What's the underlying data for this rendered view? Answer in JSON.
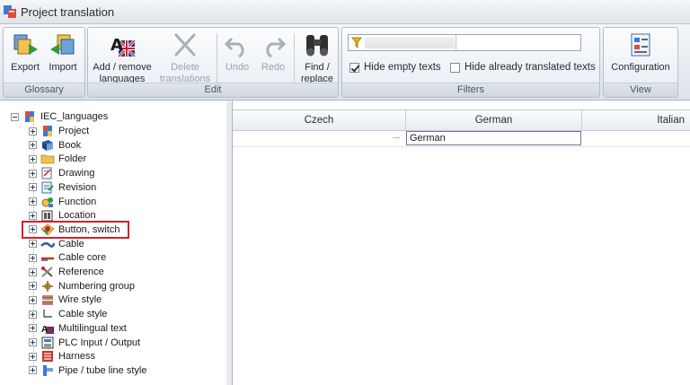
{
  "window": {
    "title": "Project translation"
  },
  "ribbon": {
    "glossary": {
      "label": "Glossary",
      "export_label": "Export",
      "import_label": "Import"
    },
    "edit": {
      "label": "Edit",
      "add_remove_line1": "Add / remove",
      "add_remove_line2": "languages",
      "delete_line1": "Delete",
      "delete_line2": "translations",
      "undo_label": "Undo",
      "redo_label": "Redo",
      "find_line1": "Find /",
      "find_line2": "replace"
    },
    "filters": {
      "label": "Filters",
      "hide_empty_label": "Hide empty texts",
      "hide_translated_label": "Hide already translated texts"
    },
    "view": {
      "label": "View",
      "configuration_label": "Configuration"
    }
  },
  "tree": {
    "root": "IEC_languages",
    "items": [
      {
        "label": "Project",
        "icon": "project-icon"
      },
      {
        "label": "Book",
        "icon": "book-icon"
      },
      {
        "label": "Folder",
        "icon": "folder-icon"
      },
      {
        "label": "Drawing",
        "icon": "drawing-icon"
      },
      {
        "label": "Revision",
        "icon": "revision-icon"
      },
      {
        "label": "Function",
        "icon": "function-icon"
      },
      {
        "label": "Location",
        "icon": "location-icon"
      },
      {
        "label": "Button, switch",
        "icon": "button-switch-icon"
      },
      {
        "label": "Cable",
        "icon": "cable-icon"
      },
      {
        "label": "Cable core",
        "icon": "cable-core-icon"
      },
      {
        "label": "Reference",
        "icon": "reference-icon"
      },
      {
        "label": "Numbering group",
        "icon": "numbering-group-icon"
      },
      {
        "label": "Wire style",
        "icon": "wire-style-icon"
      },
      {
        "label": "Cable style",
        "icon": "cable-style-icon"
      },
      {
        "label": "Multilingual text",
        "icon": "multilingual-text-icon"
      },
      {
        "label": "PLC Input / Output",
        "icon": "plc-io-icon"
      },
      {
        "label": "Harness",
        "icon": "harness-icon"
      },
      {
        "label": "Pipe / tube line style",
        "icon": "pipe-style-icon"
      }
    ]
  },
  "grid": {
    "columns": [
      "Czech",
      "German",
      "Italian"
    ],
    "row_ellipsis": "...",
    "editing_value": "German"
  }
}
